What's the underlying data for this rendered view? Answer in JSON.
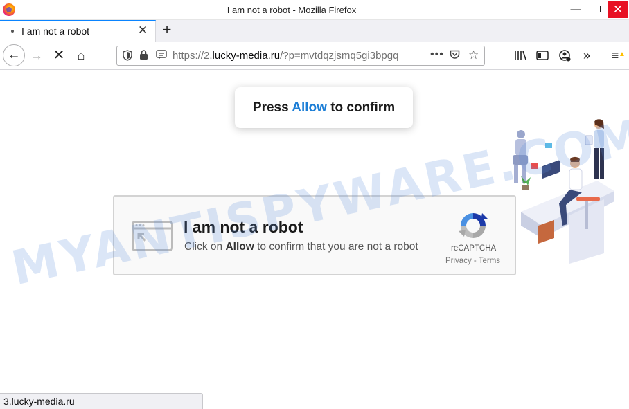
{
  "window": {
    "title": "I am not a robot - Mozilla Firefox",
    "minimize": "—",
    "maximize": "",
    "close": "✕"
  },
  "tab": {
    "title": "I am not a robot",
    "close": "✕",
    "new_tab": "+"
  },
  "nav": {
    "back": "←",
    "forward": "→",
    "stop": "✕",
    "home": "⌂"
  },
  "urlbar": {
    "prefix": "https://2.",
    "domain": "lucky-media.ru",
    "suffix": "/?p=mvtdqzjsmq5gi3bpgq",
    "more": "•••",
    "bookmark_star": "☆"
  },
  "toolbar": {
    "overflow": "»",
    "menu": "≡",
    "menu_warning": "▲"
  },
  "press_prompt": {
    "before": "Press ",
    "highlight": "Allow",
    "after": " to confirm"
  },
  "captcha": {
    "title": "I am not a robot",
    "sub_before": "Click on ",
    "sub_bold": "Allow",
    "sub_after": " to confirm that you are not a robot",
    "brand": "reCAPTCHA",
    "links": "Privacy - Terms"
  },
  "watermark": "MYANTISPYWARE.COM",
  "status": "3.lucky-media.ru",
  "colors": {
    "accent_tab": "#0a84ff",
    "allow_blue": "#1c7ed6",
    "close_red": "#e81123"
  }
}
